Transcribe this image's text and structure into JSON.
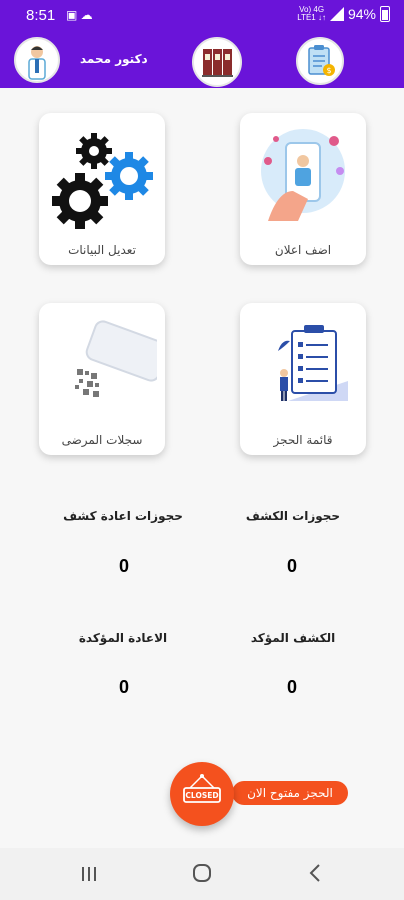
{
  "status_bar": {
    "time": "8:51",
    "left_icons": "▣ ☁",
    "signal_top": "Vo) 4G",
    "signal_bottom": "LTE1 ↓↑",
    "battery": "94%"
  },
  "header": {
    "doctor_name": "دكتور محمد",
    "icons": [
      "doctor-avatar-icon",
      "medical-files-icon",
      "clipboard-money-icon"
    ]
  },
  "cards": {
    "edit_data": "تعديل البيانات",
    "add_ad": "اضف اعلان",
    "patient_records": "سجلات المرضى",
    "booking_list": "قائمة الحجز"
  },
  "stats": {
    "revisit_bookings_label": "حجوزات اعادة كشف",
    "revisit_bookings_value": "0",
    "checkup_bookings_label": "حجوزات الكشف",
    "checkup_bookings_value": "0",
    "confirmed_revisit_label": "الاعادة المؤكدة",
    "confirmed_revisit_value": "0",
    "confirmed_checkup_label": "الكشف المؤكد",
    "confirmed_checkup_value": "0"
  },
  "fab": {
    "sign_text": "CLOSED",
    "status_text": "الحجز  مفتوح الان"
  },
  "colors": {
    "header": "#6a14d9",
    "fab": "#f4511e",
    "gear_blue": "#1e88e5"
  }
}
